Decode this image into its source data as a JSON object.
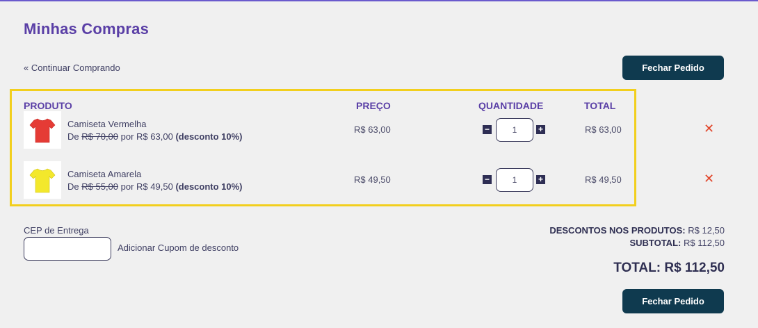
{
  "page": {
    "title": "Minhas Compras",
    "continue_link": "« Continuar Comprando",
    "close_order_top": "Fechar Pedido",
    "close_order_bottom": "Fechar Pedido"
  },
  "colors": {
    "accent": "#5a3fa6",
    "button_bg": "#0f3a4f",
    "cart_border": "#f2cf1d",
    "remove": "#e1452a"
  },
  "table": {
    "headers": {
      "produto": "PRODUTO",
      "preco": "PREÇO",
      "quantidade": "QUANTIDADE",
      "total": "TOTAL"
    },
    "rows": [
      {
        "name": "Camiseta Vermelha",
        "image": "red-tshirt",
        "image_color": "#e53b35",
        "desc_prefix": "De",
        "old_price": "R$ 70,00",
        "desc_mid": "por R$ 63,00",
        "discount": "(desconto 10%)",
        "price": "R$ 63,00",
        "quantity": "1",
        "total": "R$ 63,00",
        "remove": "✕"
      },
      {
        "name": "Camiseta Amarela",
        "image": "yellow-tshirt",
        "image_color": "#f3e82c",
        "desc_prefix": "De",
        "old_price": "R$ 55,00",
        "desc_mid": "por R$ 49,50",
        "discount": "(desconto 10%)",
        "price": "R$ 49,50",
        "quantity": "1",
        "total": "R$ 49,50",
        "remove": "✕"
      }
    ],
    "qty_minus": "−",
    "qty_plus": "+"
  },
  "shipping": {
    "cep_label": "CEP de Entrega",
    "cep_value": "",
    "coupon_link": "Adicionar Cupom de desconto"
  },
  "summary": {
    "discounts_label": "DESCONTOS NOS PRODUTOS:",
    "discounts_value": "R$ 12,50",
    "subtotal_label": "SUBTOTAL:",
    "subtotal_value": "R$ 112,50",
    "total": "TOTAL: R$ 112,50"
  }
}
